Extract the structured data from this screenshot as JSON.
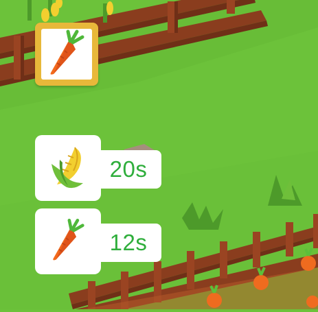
{
  "hud": {
    "selected_crop": {
      "icon": "carrot-icon",
      "frame_color": "#e8b83a"
    },
    "crops": [
      {
        "icon": "corn-icon",
        "timer": "20s"
      },
      {
        "icon": "carrot-icon",
        "timer": "12s"
      }
    ]
  },
  "colors": {
    "grass": "#6cc23a",
    "timer_text": "#2fae3c",
    "fence": "#8a3d1e"
  }
}
